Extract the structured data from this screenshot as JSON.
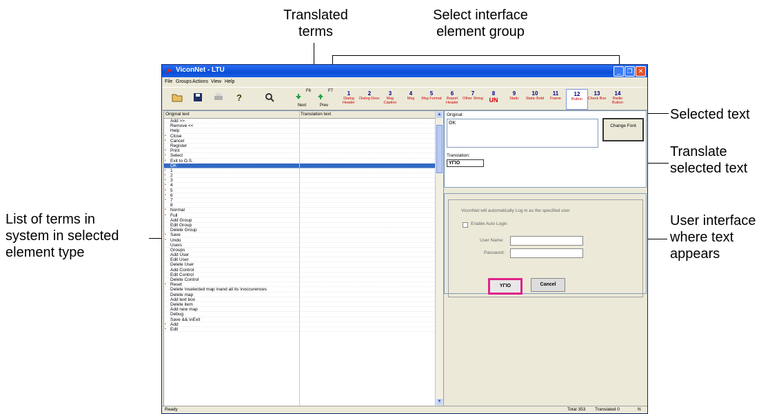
{
  "callouts": {
    "translated_terms": [
      "Translated",
      "terms"
    ],
    "select_group": [
      "Select interface",
      "element group"
    ],
    "selected_text": "Selected text",
    "translate_selected": [
      "Translate",
      "selected text"
    ],
    "list_of_terms": [
      "List of terms in",
      "system in selected",
      "element type"
    ],
    "ui_where_appears": [
      "User interface",
      "where text",
      "appears"
    ]
  },
  "window": {
    "title": "ViconNet - LTU",
    "controls": {
      "minimize": "_",
      "restore": "❐",
      "close": "✕"
    }
  },
  "menu": [
    "File",
    "Groups",
    "Actions",
    "View",
    "Help"
  ],
  "toolbar": {
    "tools": [
      "open-icon",
      "save-icon",
      "print-icon",
      "help-icon",
      "find-icon"
    ],
    "next": {
      "label": "Next",
      "key": "F6"
    },
    "prev": {
      "label": "Prev",
      "key": "F7"
    },
    "groups": [
      {
        "num": "1",
        "name": "Dialog Header"
      },
      {
        "num": "2",
        "name": "Dialog Desc"
      },
      {
        "num": "3",
        "name": "Msg Caption"
      },
      {
        "num": "4",
        "name": "Msg"
      },
      {
        "num": "5",
        "name": "Msg Format"
      },
      {
        "num": "6",
        "name": "Report Header"
      },
      {
        "num": "7",
        "name": "Other String"
      },
      {
        "num": "8",
        "name": "UN"
      },
      {
        "num": "9",
        "name": "Static"
      },
      {
        "num": "10",
        "name": "Static Bold"
      },
      {
        "num": "11",
        "name": "Frame"
      },
      {
        "num": "12",
        "name": "Button"
      },
      {
        "num": "13",
        "name": "Check Box"
      },
      {
        "num": "14",
        "name": "Radio Button"
      }
    ],
    "selected_group": "12"
  },
  "list": {
    "col_original": "Original text",
    "col_translation": "Translation text",
    "selected_item": "OK",
    "items": [
      "Add >>",
      "Remove <<",
      "Help",
      "Close",
      "Cancel",
      "Register",
      "Print",
      "Select",
      "Exit to O.S.",
      "OK",
      "1",
      "2",
      "3",
      "4",
      "5",
      "6",
      "7",
      "8",
      "Normal",
      "Full",
      "Add Group",
      "Edit Group",
      "Delete Group",
      "Save",
      "Undo",
      "Users",
      "Groups",
      "Add User",
      "Edit User",
      "Delete User",
      "Add Control",
      "Edit Control",
      "Delete Control",
      "Reset",
      "Delete \\nselected map \\nand all its \\noccurences",
      "Delete map",
      "Add text box",
      "Delete item",
      "Add new map",
      "Debug",
      "Save && \\nExit",
      "Add",
      "Edit"
    ]
  },
  "editor": {
    "original_label": "Original:",
    "original_value": "OK",
    "translation_label": "Translation:",
    "translation_value": "ΥΓΙΟ",
    "change_font": "Change Font"
  },
  "preview": {
    "message": "ViconNet will automatically Log in as the specified user",
    "auto_login": "Enable Auto Login",
    "username_label": "User Name:",
    "password_label": "Password:",
    "ok_label": "ΥΓΙΟ",
    "cancel_label": "Cancel"
  },
  "status": {
    "left": "Ready",
    "total": "Total 353",
    "translated": "Translated 0",
    "mode": "N"
  }
}
